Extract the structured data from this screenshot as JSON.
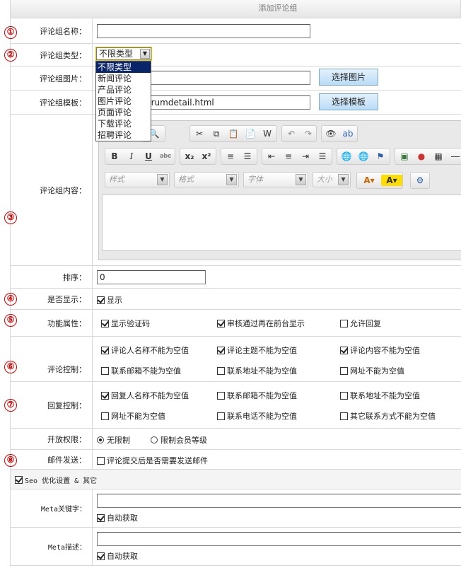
{
  "header": {
    "title": "添加评论组"
  },
  "markers": [
    "①",
    "②",
    "③",
    "④",
    "⑤",
    "⑥",
    "⑦",
    "⑧"
  ],
  "fields": {
    "name_label": "评论组名称：",
    "type_label": "评论组类型：",
    "type_value": "不限类型",
    "type_options": [
      "不限类型",
      "新闻评论",
      "产品评论",
      "图片评论",
      "页面评论",
      "下载评论",
      "招聘评论"
    ],
    "image_label": "评论组图片：",
    "image_button": "选择图片",
    "template_label": "评论组模板：",
    "template_value": "/forumdetail.html",
    "template_button": "选择模板",
    "content_label": "评论组内容：",
    "sort_label": "排序：",
    "sort_value": "0",
    "display_label": "是否显示：",
    "display_option": "显示",
    "func_label": "功能属性：",
    "func_options": [
      "显示验证码",
      "审核通过再在前台显示",
      "允许回复"
    ],
    "comment_ctrl_label": "评论控制：",
    "comment_ctrl_options": [
      "评论人名称不能为空值",
      "评论主题不能为空值",
      "评论内容不能为空值",
      "联系邮箱不能为空值",
      "联系地址不能为空值",
      "网址不能为空值"
    ],
    "reply_ctrl_label": "回复控制：",
    "reply_ctrl_options": [
      "回复人名称不能为空值",
      "联系邮箱不能为空值",
      "联系地址不能为空值",
      "网址不能为空值",
      "联系电话不能为空值",
      "其它联系方式不能为空值"
    ],
    "access_label": "开放权限：",
    "access_options": [
      "无限制",
      "限制会员等级"
    ],
    "mail_label": "邮件发送：",
    "mail_option": "评论提交后是否需要发送邮件",
    "seo_section": "Seo 优化设置 & 其它",
    "meta_kw_label": "Meta关键字：",
    "meta_desc_label": "Meta描述：",
    "auto_fetch": "自动获取"
  },
  "editor": {
    "style_dd": "样式",
    "format_dd": "格式",
    "font_dd": "字体",
    "size_dd": "大小"
  }
}
